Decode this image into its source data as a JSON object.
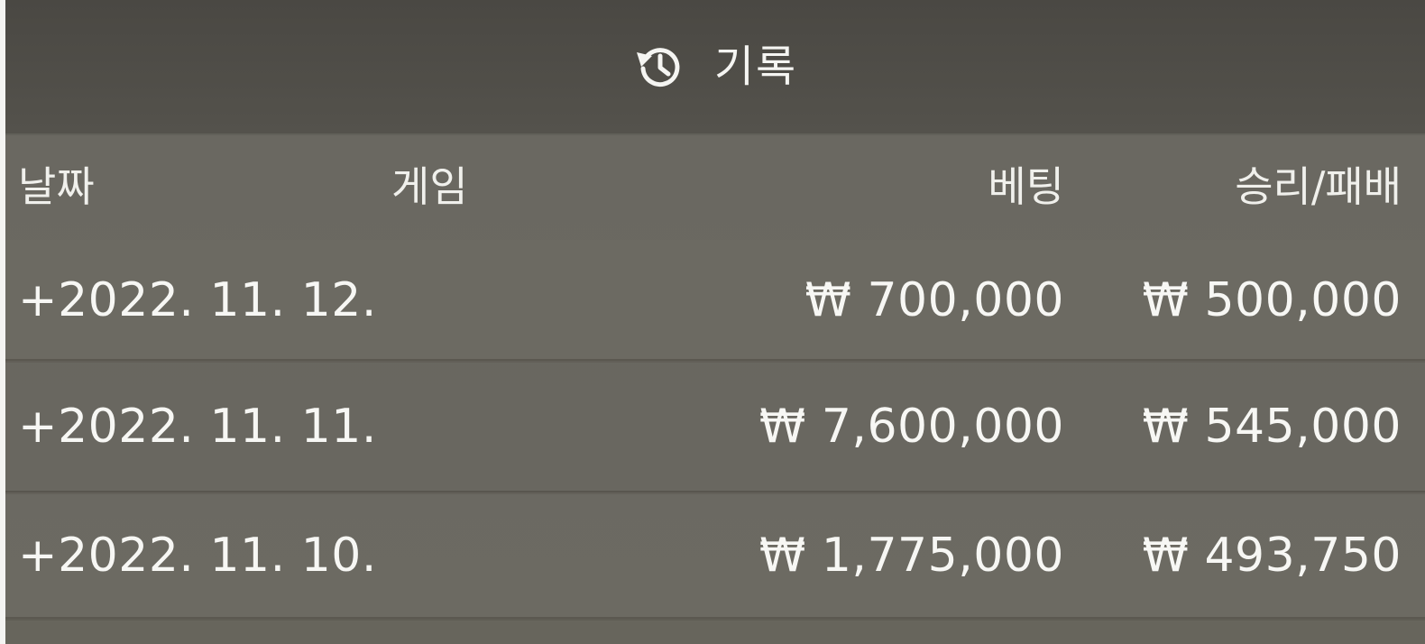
{
  "header": {
    "icon": "history-icon",
    "title": "기록"
  },
  "columns": {
    "date": "날짜",
    "game": "게임",
    "bet": "베팅",
    "win_loss": "승리/패배"
  },
  "rows": [
    {
      "date": "+2022. 11. 12.",
      "game": "",
      "bet": "₩ 700,000",
      "win_loss": "₩ 500,000"
    },
    {
      "date": "+2022. 11. 11.",
      "game": "",
      "bet": "₩ 7,600,000",
      "win_loss": "₩ 545,000"
    },
    {
      "date": "+2022. 11. 10.",
      "game": "",
      "bet": "₩ 1,775,000",
      "win_loss": "₩ 493,750"
    }
  ]
}
